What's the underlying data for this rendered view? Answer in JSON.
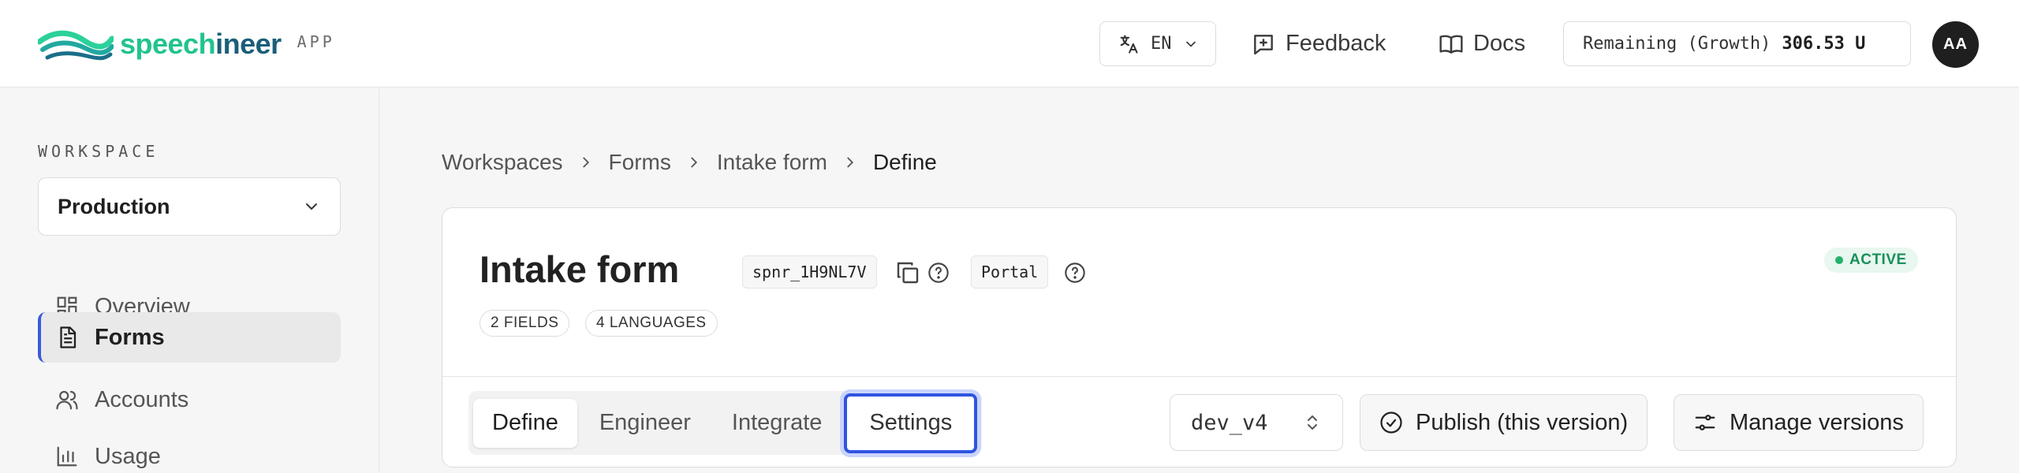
{
  "header": {
    "logo_part1": "speech",
    "logo_part2": "ineer",
    "app_label": "APP",
    "language": "EN",
    "feedback_label": "Feedback",
    "docs_label": "Docs",
    "remaining_label": "Remaining (Growth)",
    "remaining_amount": "306.53 U",
    "avatar_initials": "AA"
  },
  "sidebar": {
    "workspace_label": "WORKSPACE",
    "workspace_value": "Production",
    "items": [
      {
        "label": "Overview",
        "icon": "dashboard-icon"
      },
      {
        "label": "Forms",
        "icon": "document-icon"
      },
      {
        "label": "Accounts",
        "icon": "users-icon"
      },
      {
        "label": "Usage",
        "icon": "bar-chart-icon"
      }
    ],
    "active_index": 1
  },
  "breadcrumb": [
    "Workspaces",
    "Forms",
    "Intake form",
    "Define"
  ],
  "form": {
    "title": "Intake form",
    "id": "spnr_1H9NL7V",
    "type": "Portal",
    "status": "ACTIVE",
    "fields_count": "2 FIELDS",
    "languages_count": "4 LANGUAGES"
  },
  "tabs": [
    "Define",
    "Engineer",
    "Integrate",
    "Settings"
  ],
  "active_tab": "Define",
  "focused_tab": "Settings",
  "version": "dev_v4",
  "actions": {
    "publish_label": "Publish (this version)",
    "manage_label": "Manage versions"
  },
  "colors": {
    "accent": "#2f54e0",
    "brand_green": "#22c38e",
    "brand_dark": "#1a5e78",
    "status_active": "#22b26a"
  }
}
